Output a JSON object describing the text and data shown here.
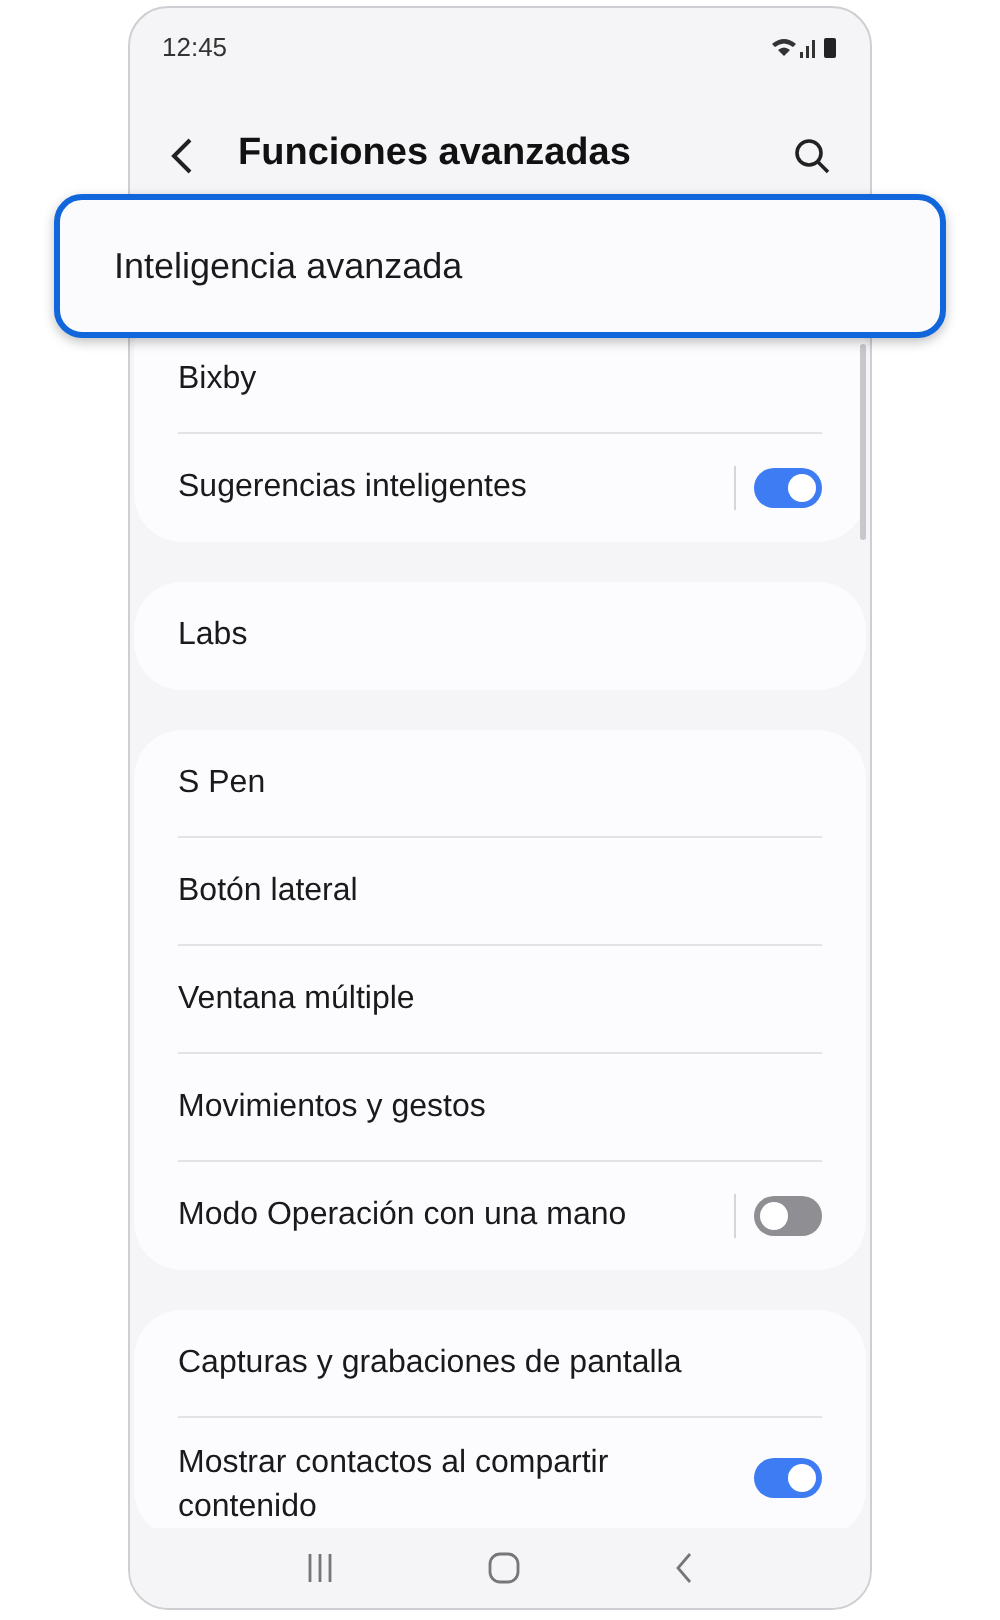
{
  "status_bar": {
    "time": "12:45"
  },
  "header": {
    "title": "Funciones avanzadas"
  },
  "highlight": {
    "label": "Inteligencia avanzada"
  },
  "groups": [
    {
      "items": [
        {
          "label": "Bixby",
          "kind": "link"
        },
        {
          "label": "Sugerencias inteligentes",
          "kind": "toggle",
          "on": true
        }
      ]
    },
    {
      "items": [
        {
          "label": "Labs",
          "kind": "link"
        }
      ]
    },
    {
      "items": [
        {
          "label": "S Pen",
          "kind": "link"
        },
        {
          "label": "Botón lateral",
          "kind": "link"
        },
        {
          "label": "Ventana múltiple",
          "kind": "link"
        },
        {
          "label": "Movimientos y gestos",
          "kind": "link"
        },
        {
          "label": "Modo Operación con una mano",
          "kind": "toggle",
          "on": false
        }
      ]
    },
    {
      "items": [
        {
          "label": "Capturas y grabaciones de pantalla",
          "kind": "link"
        },
        {
          "label": "Mostrar contactos al compartir contenido",
          "kind": "plain-toggle",
          "on": true
        }
      ]
    }
  ]
}
